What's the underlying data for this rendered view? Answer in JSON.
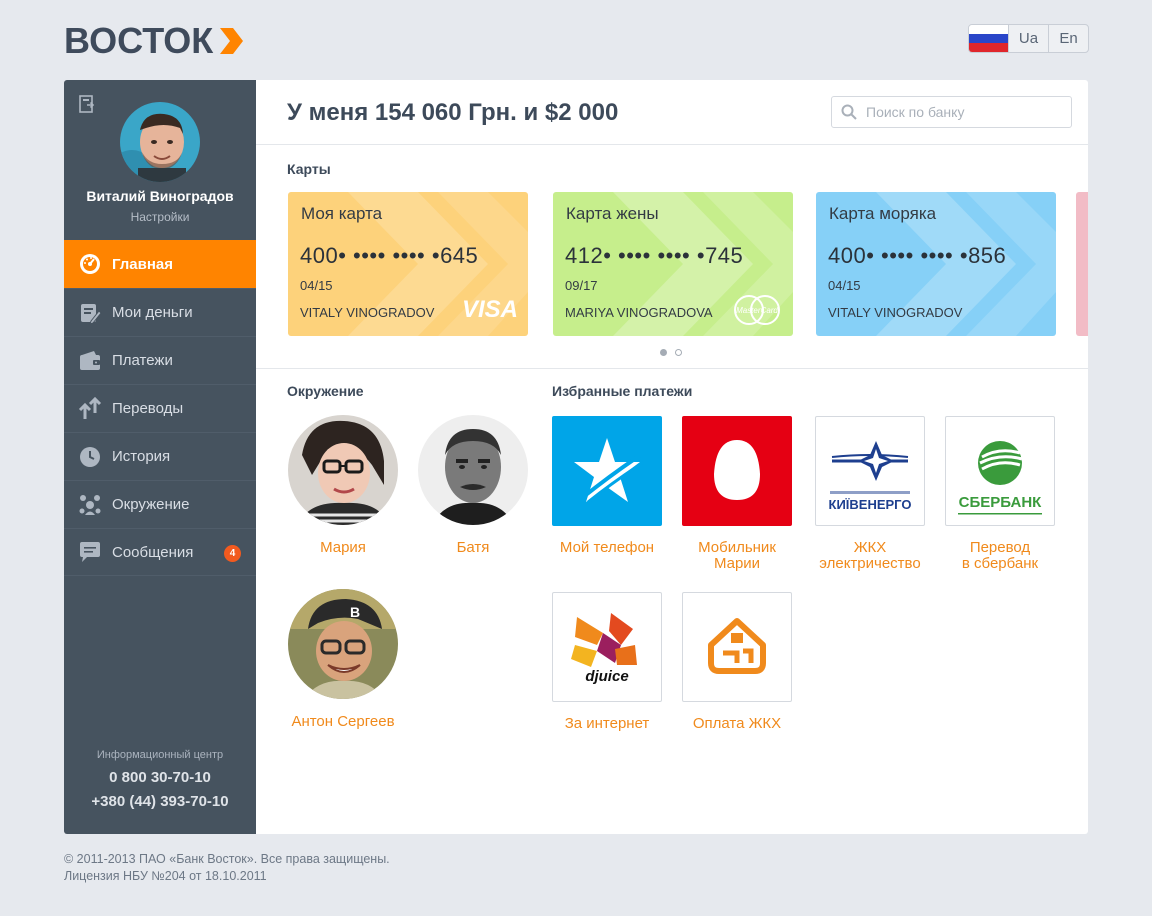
{
  "header": {
    "logo_text": "ВОСТОК",
    "languages": [
      "Ua",
      "En"
    ]
  },
  "user": {
    "name": "Виталий Виноградов",
    "settings": "Настройки"
  },
  "menu": [
    {
      "label": "Главная",
      "icon": "dashboard-icon",
      "active": true
    },
    {
      "label": "Мои деньги",
      "icon": "money-icon",
      "active": false
    },
    {
      "label": "Платежи",
      "icon": "wallet-icon",
      "active": false
    },
    {
      "label": "Переводы",
      "icon": "transfer-arrows-icon",
      "active": false
    },
    {
      "label": "История",
      "icon": "clock-icon",
      "active": false
    },
    {
      "label": "Окружение",
      "icon": "people-icon",
      "active": false
    },
    {
      "label": "Сообщения",
      "icon": "message-icon",
      "active": false,
      "badge": "4"
    }
  ],
  "info": {
    "title": "Информационный центр",
    "phone1": "0 800 30-70-10",
    "phone2": "+380 (44) 393-70-10"
  },
  "main": {
    "balance": "У меня 154 060 Грн. и $2 000",
    "search_placeholder": "Поиск по банку",
    "cards_title": "Карты",
    "people_title": "Окружение",
    "favorites_title": "Избранные платежи"
  },
  "cards": [
    {
      "name": "Моя карта",
      "number": "400• •••• •••• •645",
      "expiry": "04/15",
      "holder": "VITALY VINOGRADOV",
      "brand": "VISA",
      "color": "#fdd27b"
    },
    {
      "name": "Карта жены",
      "number": "412• •••• •••• •745",
      "expiry": "09/17",
      "holder": "MARIYA VINOGRADOVA",
      "brand": "MasterCard",
      "color": "#c6ee8c"
    },
    {
      "name": "Карта моряка",
      "number": "400• •••• •••• •856",
      "expiry": "04/15",
      "holder": "VITALY VINOGRADOV",
      "brand": "",
      "color": "#86d0f7"
    }
  ],
  "people": [
    {
      "name": "Мария"
    },
    {
      "name": "Батя"
    },
    {
      "name": "Антон Сергеев"
    }
  ],
  "favorites": [
    {
      "line1": "Мой телефон",
      "line2": "",
      "logo": "kyivstar-star-logo"
    },
    {
      "line1": "Мобильник",
      "line2": "Марии",
      "logo": "mts-egg-logo"
    },
    {
      "line1": "ЖКХ",
      "line2": "электричество",
      "logo": "kyivenergo-logo",
      "logo_text": "КИЇВЕНЕРГО"
    },
    {
      "line1": "Перевод",
      "line2": "в сбербанк",
      "logo": "sberbank-logo",
      "logo_text": "СБЕРБАНК"
    },
    {
      "line1": "За интернет",
      "line2": "",
      "logo": "djuice-logo",
      "logo_text": "djuice"
    },
    {
      "line1": "Оплата ЖКХ",
      "line2": "",
      "logo": "house-utilities-logo"
    }
  ],
  "footer": {
    "line1": "© 2011-2013 ПАО «Банк Восток». Все права защищены.",
    "line2": "Лицензия НБУ №204 от 18.10.2011"
  },
  "colors": {
    "accent": "#ff8400",
    "sidebar": "#46535f",
    "link": "#f08a1c"
  }
}
